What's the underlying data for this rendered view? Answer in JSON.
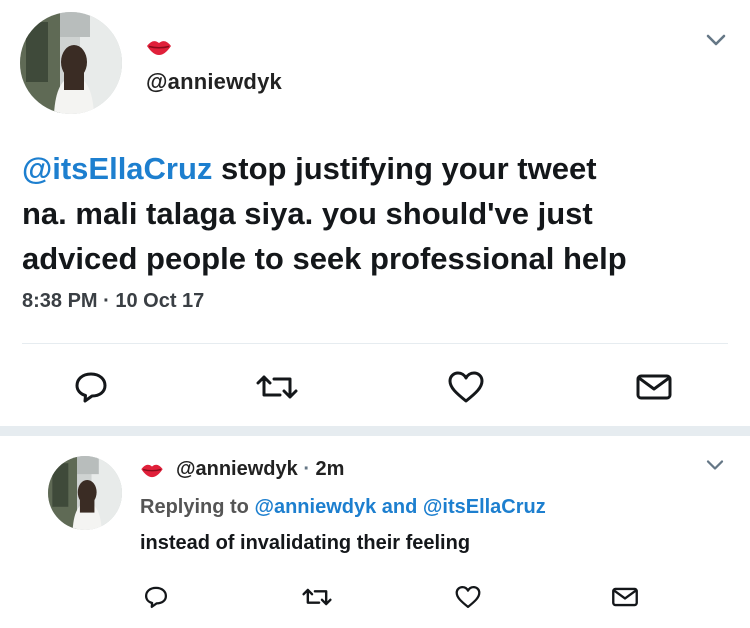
{
  "main_tweet": {
    "author_icon": "lips-emoji",
    "handle": "@anniewdyk",
    "text_mention": "@itsEllaCruz",
    "text_line1_rest": " stop justifying your tweet",
    "text_line2": "na. mali talaga siya. you should've just",
    "text_line3": "adviced people to seek professional help",
    "timestamp": "8:38 PM · 10 Oct 17",
    "actions": [
      "reply-icon",
      "retweet-icon",
      "like-icon",
      "message-icon"
    ]
  },
  "reply_tweet": {
    "author_icon": "lips-emoji",
    "handle": "@anniewdyk",
    "separator": " · ",
    "time": "2m",
    "replying_prefix": "Replying to ",
    "replying_user1": "@anniewdyk",
    "replying_and": " and ",
    "replying_user2": "@itsEllaCruz",
    "text": "instead of invalidating their feeling",
    "actions": [
      "reply-icon",
      "retweet-icon",
      "like-icon",
      "message-icon"
    ]
  },
  "colors": {
    "mention": "#1d7fcf",
    "text": "#14171a",
    "icon": "#657786",
    "lips": "#e0203a",
    "divider": "#e6ecf0"
  }
}
